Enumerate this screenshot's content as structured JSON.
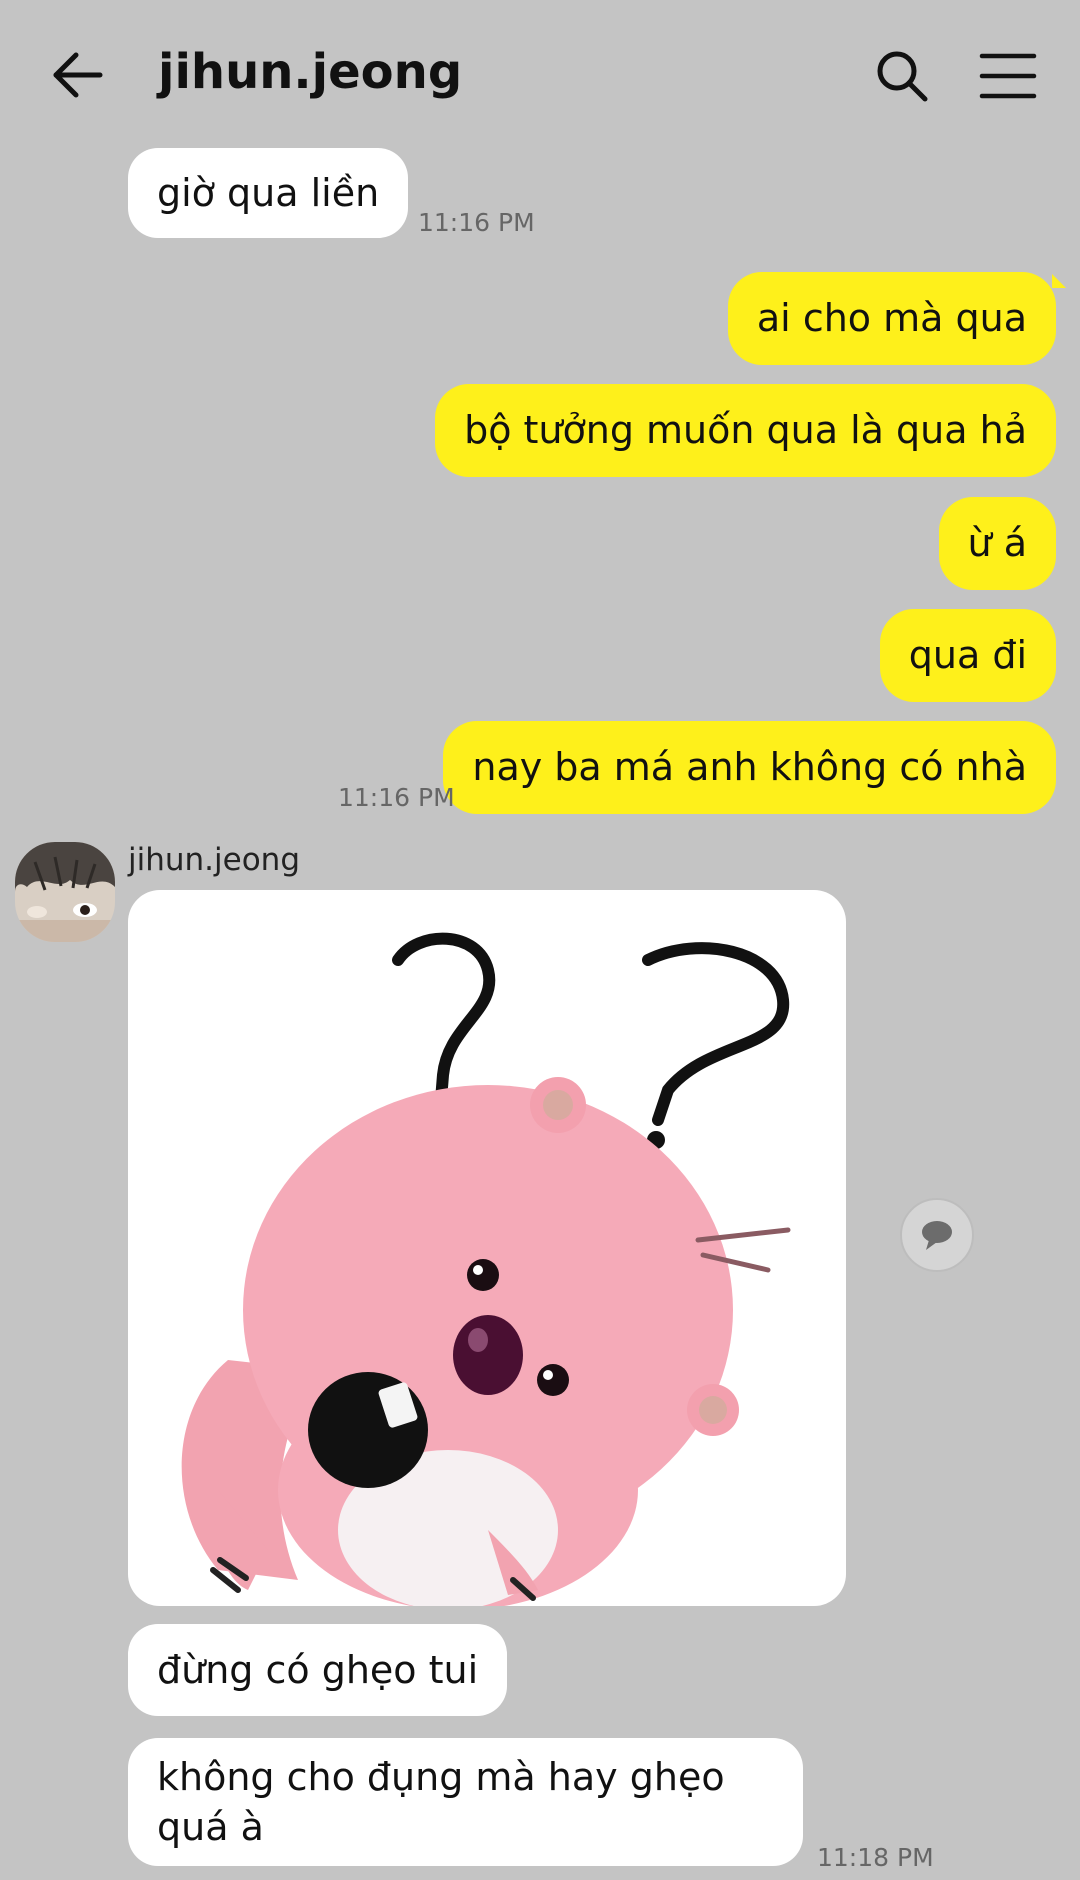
{
  "header": {
    "title": "jihun.jeong",
    "back_icon": "arrow-left-icon",
    "search_icon": "search-icon",
    "menu_icon": "hamburger-menu-icon"
  },
  "messages": [
    {
      "id": 1,
      "direction": "in",
      "text": "giờ qua liền",
      "time": "11:16 PM"
    },
    {
      "id": 2,
      "direction": "out",
      "text": "ai cho mà qua"
    },
    {
      "id": 3,
      "direction": "out",
      "text": "bộ tưởng muốn qua là qua hả"
    },
    {
      "id": 4,
      "direction": "out",
      "text": "ừ á"
    },
    {
      "id": 5,
      "direction": "out",
      "text": "qua đi"
    },
    {
      "id": 6,
      "direction": "out",
      "text": "nay ba má anh không có nhà",
      "time": "11:16 PM"
    },
    {
      "id": 7,
      "direction": "in",
      "sender": "jihun.jeong",
      "sticker": "pink-beaver-question-sticker"
    },
    {
      "id": 8,
      "direction": "in",
      "text": "đừng có ghẹo tui"
    },
    {
      "id": 9,
      "direction": "in",
      "text": "không cho đụng mà hay ghẹo quá à",
      "time": "11:18 PM"
    }
  ],
  "colors": {
    "background": "#c4c4c4",
    "outgoing_bubble": "#fef01b",
    "incoming_bubble": "#ffffff",
    "timestamp": "#666666"
  },
  "icons": {
    "reply": "speech-bubble-icon",
    "avatar": "avatar"
  }
}
